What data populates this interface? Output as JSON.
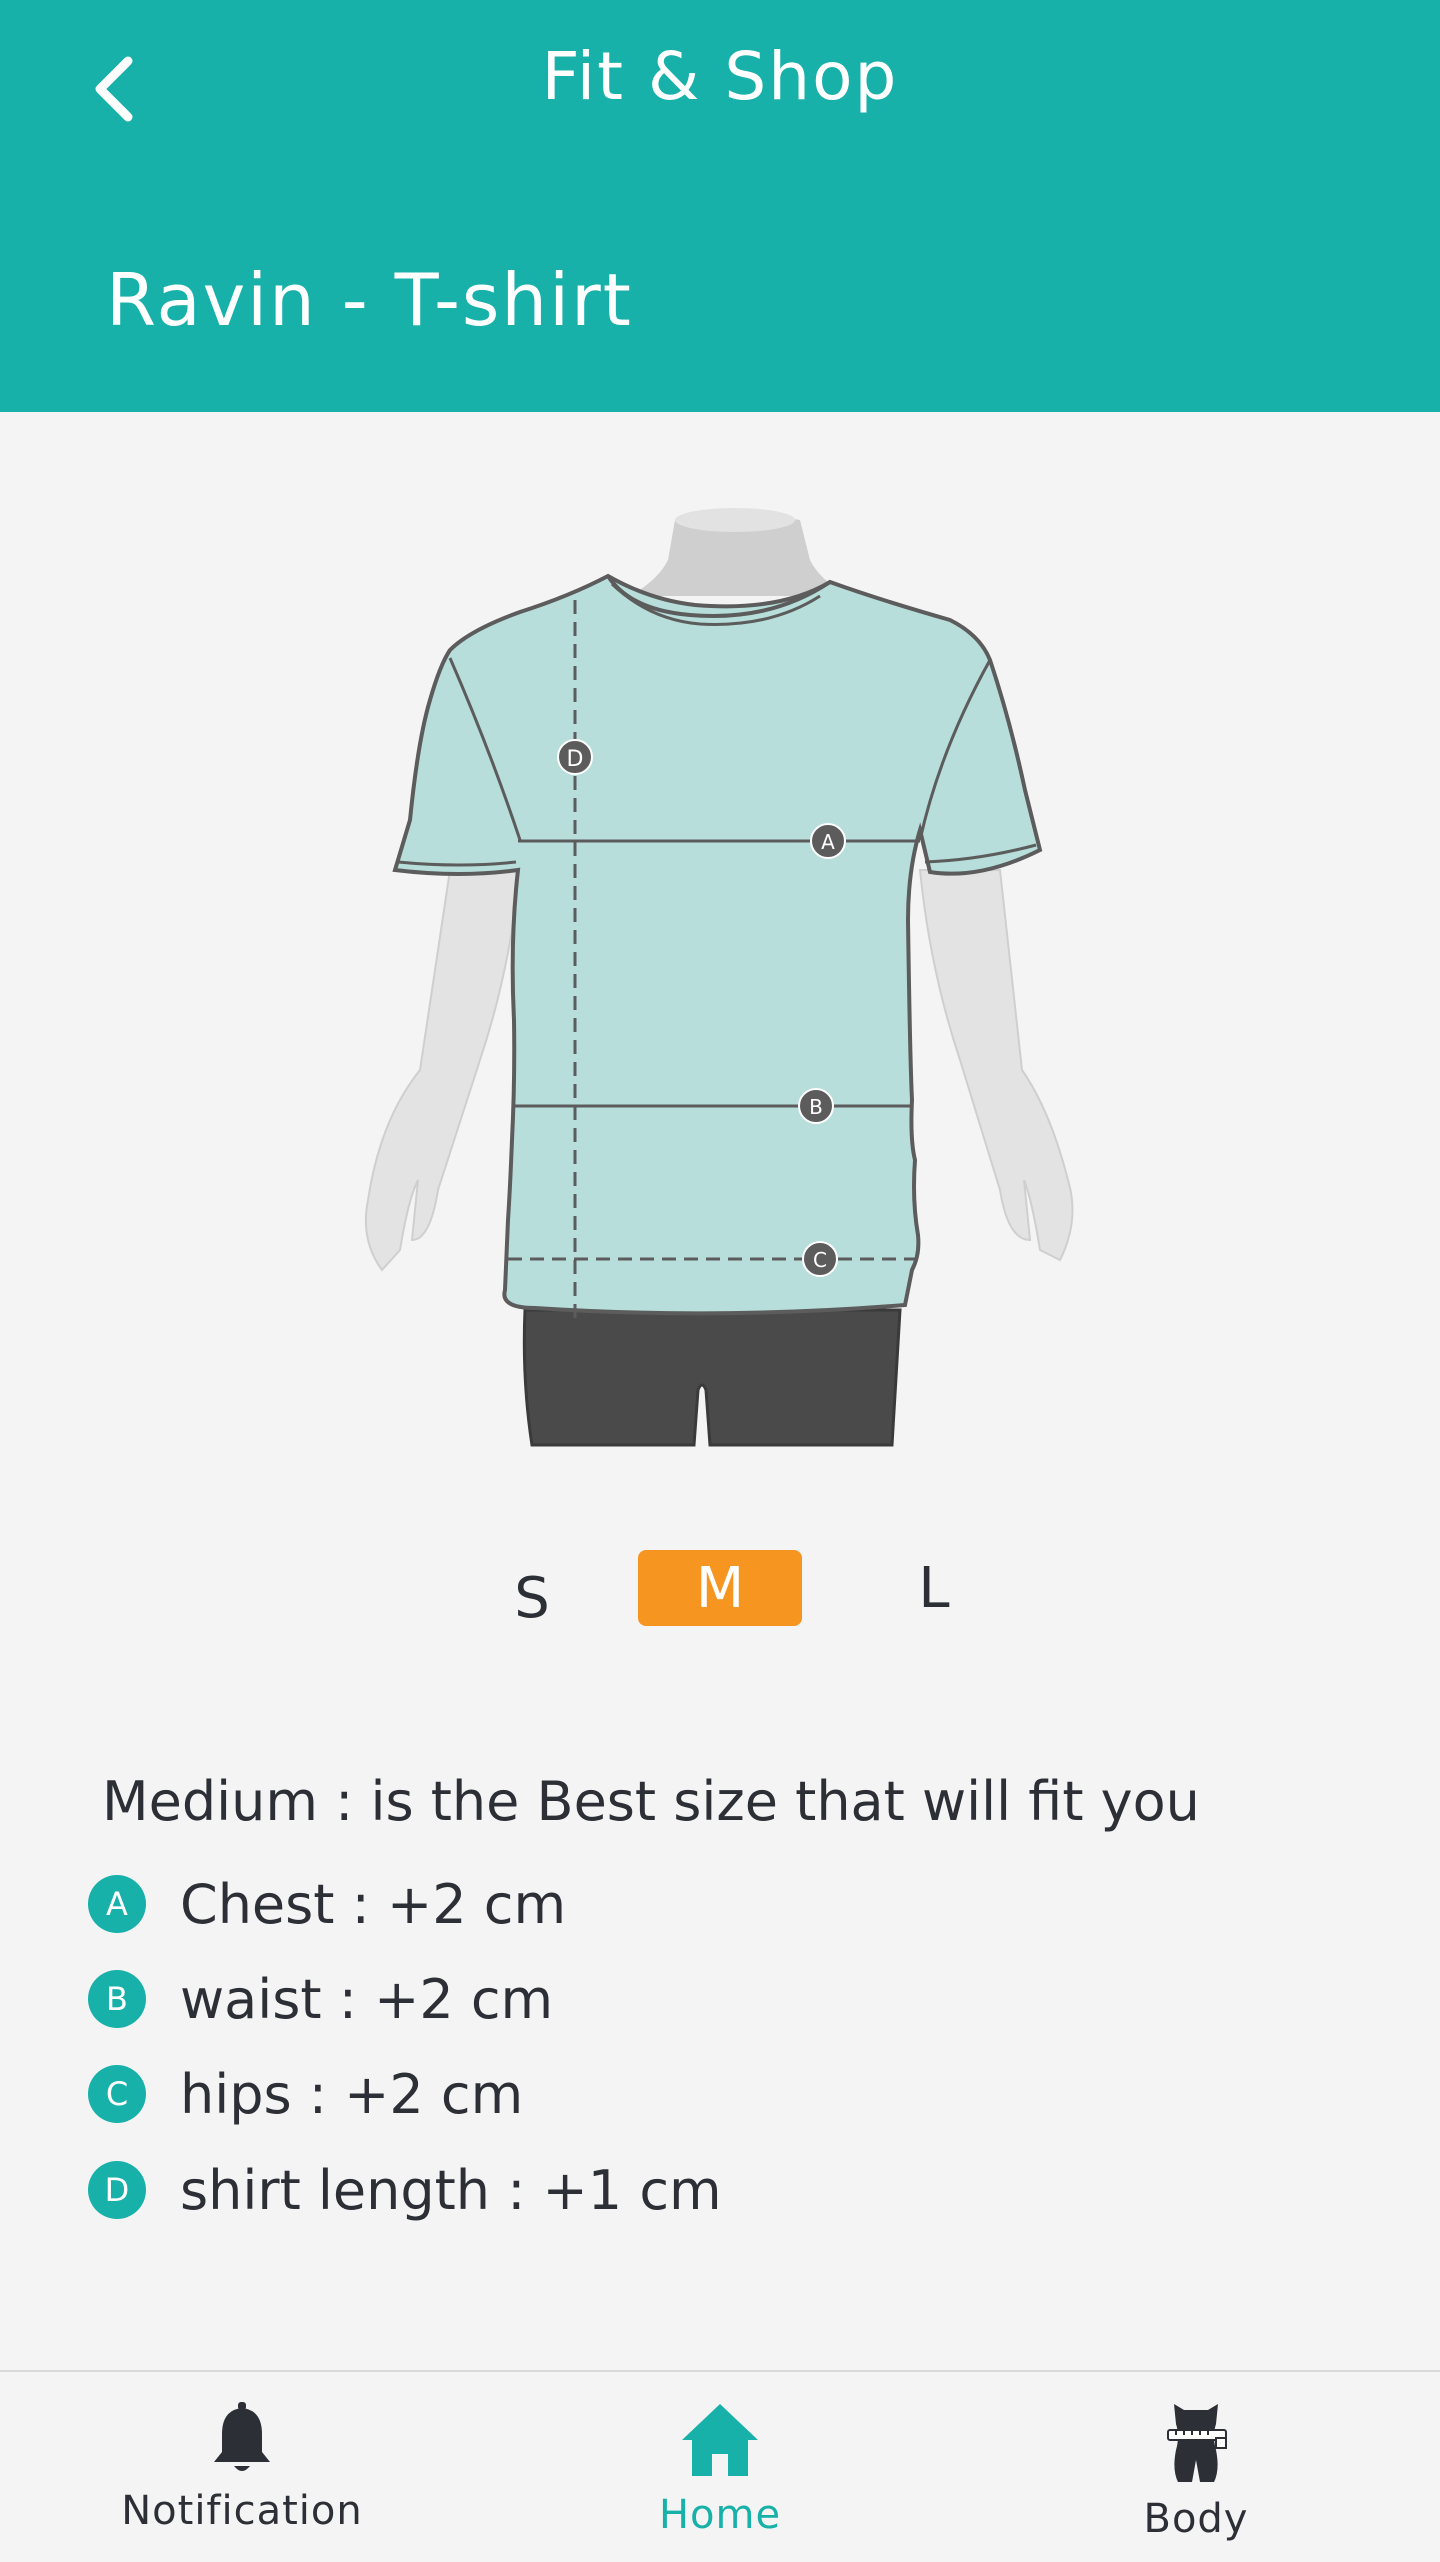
{
  "header": {
    "title": "Fit & Shop",
    "product_title": "Ravin - T-shirt",
    "back_icon": "chevron-left-icon"
  },
  "figure": {
    "marker_a": "A",
    "marker_b": "B",
    "marker_c": "C",
    "marker_d": "D"
  },
  "sizes": {
    "options": [
      "S",
      "M",
      "L"
    ],
    "selected": "M"
  },
  "fit": {
    "summary": "Medium : is the Best size that will fit you",
    "measurements": [
      {
        "badge": "A",
        "text": "Chest : +2 cm"
      },
      {
        "badge": "B",
        "text": "waist : +2 cm"
      },
      {
        "badge": "C",
        "text": "hips : +2 cm"
      },
      {
        "badge": "D",
        "text": "shirt length : +1 cm"
      }
    ]
  },
  "nav": {
    "items": [
      {
        "label": "Notification",
        "icon": "bell-icon"
      },
      {
        "label": "Home",
        "icon": "home-icon"
      },
      {
        "label": "Body",
        "icon": "body-measure-icon"
      }
    ],
    "active": "Home"
  },
  "colors": {
    "accent": "#17b1aa",
    "selected_size": "#f6951f",
    "text": "#2d2f36",
    "background": "#f4f4f4"
  }
}
